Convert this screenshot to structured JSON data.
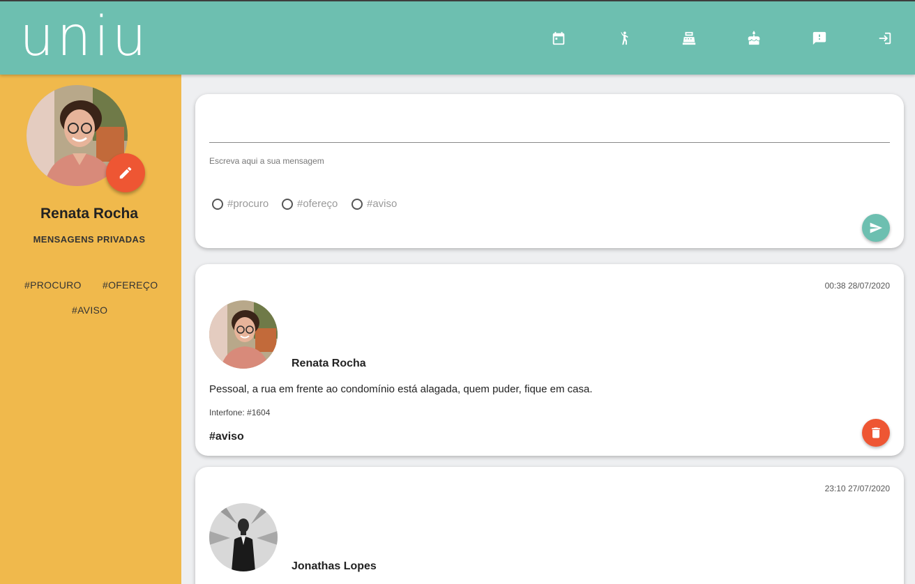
{
  "app": {
    "logo": "uniu"
  },
  "nav": [
    {
      "name": "calendar-icon"
    },
    {
      "name": "person-exercise-icon"
    },
    {
      "name": "cash-register-icon"
    },
    {
      "name": "cake-icon"
    },
    {
      "name": "feedback-icon"
    },
    {
      "name": "logout-icon"
    }
  ],
  "colors": {
    "header": "#6dbfb0",
    "sidebar": "#f0b94c",
    "accent": "#ee5633",
    "send": "#6dbfb0"
  },
  "profile": {
    "name": "Renata Rocha",
    "private_messages": "MENSAGENS PRIVADAS"
  },
  "sidebar_tags": {
    "procuro": "#PROCURO",
    "ofereco": "#OFEREÇO",
    "aviso": "#AVISO"
  },
  "composer": {
    "value": "",
    "hint": "Escreva aqui a sua mensagem",
    "options": [
      "#procuro",
      "#ofereço",
      "#aviso"
    ]
  },
  "posts": [
    {
      "time": "00:38 28/07/2020",
      "author": "Renata Rocha",
      "text": "Pessoal, a rua em frente ao condomínio está alagada, quem puder, fique em casa.",
      "interfone": "Interfone: #1604",
      "tag": "#aviso"
    },
    {
      "time": "23:10 27/07/2020",
      "author": "Jonathas Lopes"
    }
  ]
}
